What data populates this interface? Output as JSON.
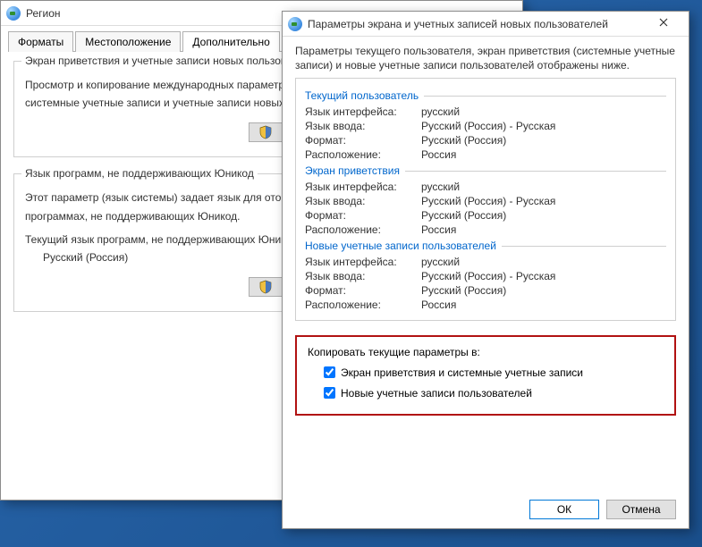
{
  "region": {
    "title": "Регион",
    "tabs": [
      "Форматы",
      "Местоположение",
      "Дополнительно"
    ],
    "group1": {
      "title": "Экран приветствия и учетные записи новых пользователей",
      "line1": "Просмотр и копирование международных параметров на",
      "line2": "системные учетные записи и учетные записи новых пользователей."
    },
    "group2": {
      "title": "Язык программ, не поддерживающих Юникод",
      "line1": "Этот параметр (язык системы) задает язык для отображения",
      "line2": "программах, не поддерживающих Юникод.",
      "line3": "Текущий язык программ, не поддерживающих Юникод:",
      "lang": "Русский (Россия)"
    }
  },
  "params": {
    "title": "Параметры экрана и учетных записей новых пользователей",
    "intro": "Параметры текущего пользователя, экран приветствия (системные учетные записи) и новые учетные записи пользователей отображены ниже.",
    "labels": {
      "ui_lang": "Язык интерфейса:",
      "input_lang": "Язык ввода:",
      "format": "Формат:",
      "location": "Расположение:"
    },
    "sections": [
      {
        "head": "Текущий пользователь",
        "ui_lang": "русский",
        "input_lang": "Русский (Россия) - Русская",
        "format": "Русский (Россия)",
        "location": "Россия"
      },
      {
        "head": "Экран приветствия",
        "ui_lang": "русский",
        "input_lang": "Русский (Россия) - Русская",
        "format": "Русский (Россия)",
        "location": "Россия"
      },
      {
        "head": "Новые учетные записи пользователей",
        "ui_lang": "русский",
        "input_lang": "Русский (Россия) - Русская",
        "format": "Русский (Россия)",
        "location": "Россия"
      }
    ],
    "copy": {
      "title": "Копировать текущие параметры в:",
      "cb1": "Экран приветствия и системные учетные записи",
      "cb2": "Новые учетные записи пользователей"
    },
    "buttons": {
      "ok": "ОК",
      "cancel": "Отмена"
    }
  }
}
